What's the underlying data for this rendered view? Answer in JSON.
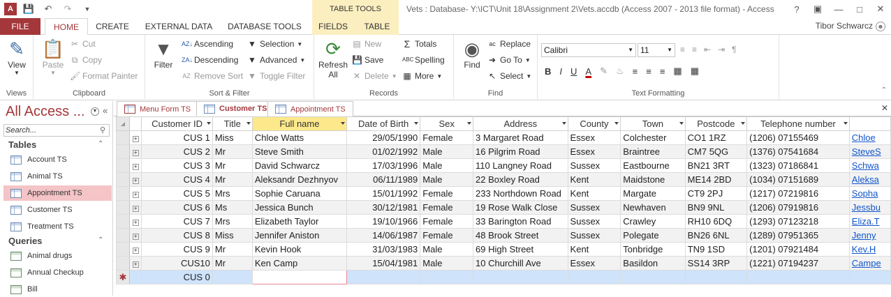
{
  "window": {
    "title": "Vets : Database- Y:\\ICT\\Unit 18\\Assignment 2\\Vets.accdb (Access 2007 - 2013 file format) - Access",
    "contextual_group": "TABLE TOOLS",
    "user": "Tibor Schwarcz"
  },
  "ribbon_tabs": {
    "file": "FILE",
    "home": "HOME",
    "create": "CREATE",
    "external": "EXTERNAL DATA",
    "dbtools": "DATABASE TOOLS",
    "fields": "FIELDS",
    "table": "TABLE"
  },
  "ribbon": {
    "views": {
      "label": "Views",
      "view": "View"
    },
    "clipboard": {
      "label": "Clipboard",
      "paste": "Paste",
      "cut": "Cut",
      "copy": "Copy",
      "format_painter": "Format Painter"
    },
    "sort_filter": {
      "label": "Sort & Filter",
      "filter": "Filter",
      "ascending": "Ascending",
      "descending": "Descending",
      "remove_sort": "Remove Sort",
      "selection": "Selection",
      "advanced": "Advanced",
      "toggle_filter": "Toggle Filter"
    },
    "records": {
      "label": "Records",
      "refresh": "Refresh",
      "refresh2": "All",
      "new": "New",
      "save": "Save",
      "delete": "Delete",
      "totals": "Totals",
      "spelling": "Spelling",
      "more": "More"
    },
    "find": {
      "label": "Find",
      "find": "Find",
      "replace": "Replace",
      "goto": "Go To",
      "select": "Select"
    },
    "text": {
      "label": "Text Formatting",
      "font": "Calibri",
      "size": "11"
    }
  },
  "nav": {
    "title": "All Access ...",
    "search_placeholder": "Search...",
    "tables_label": "Tables",
    "tables": [
      "Account TS",
      "Animal TS",
      "Appointment TS",
      "Customer TS",
      "Treatment TS"
    ],
    "queries_label": "Queries",
    "queries": [
      "Animal drugs",
      "Annual Checkup",
      "Bill"
    ]
  },
  "doc_tabs": [
    "Menu Form TS",
    "Customer TS",
    "Appointment TS"
  ],
  "grid": {
    "columns": [
      "Customer ID",
      "Title",
      "Full name",
      "Date of Birth",
      "Sex",
      "Address",
      "County",
      "Town",
      "Postcode",
      "Telephone number",
      ""
    ],
    "rows": [
      [
        "CUS 1",
        "Miss",
        "Chloe Watts",
        "29/05/1990",
        "Female",
        "3 Margaret Road",
        "Essex",
        "Colchester",
        "CO1  1RZ",
        "(1206) 07155469",
        "Chloe"
      ],
      [
        "CUS 2",
        "Mr",
        "Steve Smith",
        "01/02/1992",
        "Male",
        "16 Pilgrim Road",
        "Essex",
        "Braintree",
        "CM7  5QG",
        "(1376) 07541684",
        "SteveS"
      ],
      [
        "CUS 3",
        "Mr",
        "David Schwarcz",
        "17/03/1996",
        "Male",
        "110 Langney Road",
        "Sussex",
        "Eastbourne",
        "BN21 3RT",
        "(1323) 07186841",
        "Schwa"
      ],
      [
        "CUS 4",
        "Mr",
        "Aleksandr Dezhnyov",
        "06/11/1989",
        "Male",
        "22 Boxley Road",
        "Kent",
        "Maidstone",
        "ME14 2BD",
        "(1034) 07151689",
        "Aleksa"
      ],
      [
        "CUS 5",
        "Mrs",
        "Sophie Caruana",
        "15/01/1992",
        "Female",
        "233 Northdown Road",
        "Kent",
        "Margate",
        "CT9  2PJ",
        "(1217) 07219816",
        "Sopha"
      ],
      [
        "CUS 6",
        "Ms",
        "Jessica Bunch",
        "30/12/1981",
        "Female",
        "19 Rose Walk Close",
        "Sussex",
        "Newhaven",
        "BN9  9NL",
        "(1206) 07919816",
        "Jessbu"
      ],
      [
        "CUS 7",
        "Mrs",
        "Elizabeth Taylor",
        "19/10/1966",
        "Female",
        "33 Barington Road",
        "Sussex",
        "Crawley",
        "RH10 6DQ",
        "(1293) 07123218",
        "Eliza.T"
      ],
      [
        "CUS 8",
        "Miss",
        "Jennifer Aniston",
        "14/06/1987",
        "Female",
        "48 Brook Street",
        "Sussex",
        "Polegate",
        "BN26 6NL",
        "(1289) 07951365",
        "Jenny"
      ],
      [
        "CUS 9",
        "Mr",
        "Kevin Hook",
        "31/03/1983",
        "Male",
        "69 High Street",
        "Kent",
        "Tonbridge",
        "TN9  1SD",
        "(1201) 07921484",
        "Kev.H"
      ],
      [
        "CUS10",
        "Mr",
        "Ken Camp",
        "15/04/1981",
        "Male",
        "10 Churchill Ave",
        "Essex",
        "Basildon",
        "SS14 3RP",
        "(1221) 07194237",
        "Campe"
      ]
    ],
    "new_row_id": "CUS 0",
    "new_row_marker": "✱"
  },
  "colors": {
    "accent": "#a4373a",
    "contextual": "#fbefc0",
    "selected_nav": "#f4c4c6",
    "new_row": "#cfe3fb"
  }
}
